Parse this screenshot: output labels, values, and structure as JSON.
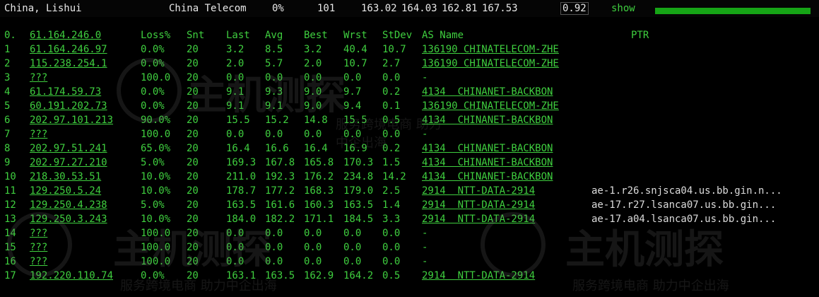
{
  "header": {
    "location": "China, Lishui",
    "isp": "China Telecom",
    "loss": "0%",
    "sent": "101",
    "last": "163.02",
    "avg": "164.03",
    "best": "162.81",
    "worst": "167.53",
    "stdev": "0.92",
    "show_label": "show",
    "bar_fill": 1.0
  },
  "columns": {
    "host": "61.164.246.0",
    "idx0": "0.",
    "loss": "Loss%",
    "snt": "Snt",
    "last": "Last",
    "avg": "Avg",
    "best": "Best",
    "wrst": "Wrst",
    "stdev": "StDev",
    "as": "AS Name",
    "ptr": "PTR"
  },
  "hops": [
    {
      "idx": "1",
      "host": "61.164.246.97",
      "loss": "0.0%",
      "snt": "20",
      "last": "3.2",
      "avg": "8.5",
      "best": "3.2",
      "wrst": "40.4",
      "stdev": "10.7",
      "as": "136190 CHINATELECOM-ZHE",
      "ptr": ""
    },
    {
      "idx": "2",
      "host": "115.238.254.1",
      "loss": "0.0%",
      "snt": "20",
      "last": "2.0",
      "avg": "5.7",
      "best": "2.0",
      "wrst": "10.7",
      "stdev": "2.7",
      "as": "136190 CHINATELECOM-ZHE",
      "ptr": ""
    },
    {
      "idx": "3",
      "host": "???",
      "loss": "100.0",
      "snt": "20",
      "last": "0.0",
      "avg": "0.0",
      "best": "0.0",
      "wrst": "0.0",
      "stdev": "0.0",
      "as": "-",
      "ptr": ""
    },
    {
      "idx": "4",
      "host": "61.174.59.73",
      "loss": "0.0%",
      "snt": "20",
      "last": "9.1",
      "avg": "9.3",
      "best": "9.0",
      "wrst": "9.7",
      "stdev": "0.2",
      "as": "4134  CHINANET-BACKBON",
      "ptr": ""
    },
    {
      "idx": "5",
      "host": "60.191.202.73",
      "loss": "0.0%",
      "snt": "20",
      "last": "9.1",
      "avg": "9.1",
      "best": "9.0",
      "wrst": "9.4",
      "stdev": "0.1",
      "as": "136190 CHINATELECOM-ZHE",
      "ptr": ""
    },
    {
      "idx": "6",
      "host": "202.97.101.213",
      "loss": "90.0%",
      "snt": "20",
      "last": "15.5",
      "avg": "15.2",
      "best": "14.8",
      "wrst": "15.5",
      "stdev": "0.5",
      "as": "4134  CHINANET-BACKBON",
      "ptr": ""
    },
    {
      "idx": "7",
      "host": "???",
      "loss": "100.0",
      "snt": "20",
      "last": "0.0",
      "avg": "0.0",
      "best": "0.0",
      "wrst": "0.0",
      "stdev": "0.0",
      "as": "-",
      "ptr": ""
    },
    {
      "idx": "8",
      "host": "202.97.51.241",
      "loss": "65.0%",
      "snt": "20",
      "last": "16.4",
      "avg": "16.6",
      "best": "16.4",
      "wrst": "16.9",
      "stdev": "0.2",
      "as": "4134  CHINANET-BACKBON",
      "ptr": ""
    },
    {
      "idx": "9",
      "host": "202.97.27.210",
      "loss": "5.0%",
      "snt": "20",
      "last": "169.3",
      "avg": "167.8",
      "best": "165.8",
      "wrst": "170.3",
      "stdev": "1.5",
      "as": "4134  CHINANET-BACKBON",
      "ptr": ""
    },
    {
      "idx": "10",
      "host": "218.30.53.51",
      "loss": "10.0%",
      "snt": "20",
      "last": "211.0",
      "avg": "192.3",
      "best": "176.2",
      "wrst": "234.8",
      "stdev": "14.2",
      "as": "4134  CHINANET-BACKBON",
      "ptr": ""
    },
    {
      "idx": "11",
      "host": "129.250.5.24",
      "loss": "10.0%",
      "snt": "20",
      "last": "178.7",
      "avg": "177.2",
      "best": "168.3",
      "wrst": "179.0",
      "stdev": "2.5",
      "as": "2914  NTT-DATA-2914",
      "ptr": "ae-1.r26.snjsca04.us.bb.gin.n..."
    },
    {
      "idx": "12",
      "host": "129.250.4.238",
      "loss": "5.0%",
      "snt": "20",
      "last": "163.5",
      "avg": "161.6",
      "best": "160.3",
      "wrst": "163.5",
      "stdev": "1.4",
      "as": "2914  NTT-DATA-2914",
      "ptr": "ae-17.r27.lsanca07.us.bb.gin..."
    },
    {
      "idx": "13",
      "host": "129.250.3.243",
      "loss": "10.0%",
      "snt": "20",
      "last": "184.0",
      "avg": "182.2",
      "best": "171.1",
      "wrst": "184.5",
      "stdev": "3.3",
      "as": "2914  NTT-DATA-2914",
      "ptr": "ae-17.a04.lsanca07.us.bb.gin..."
    },
    {
      "idx": "14",
      "host": "???",
      "loss": "100.0",
      "snt": "20",
      "last": "0.0",
      "avg": "0.0",
      "best": "0.0",
      "wrst": "0.0",
      "stdev": "0.0",
      "as": "-",
      "ptr": ""
    },
    {
      "idx": "15",
      "host": "???",
      "loss": "100.0",
      "snt": "20",
      "last": "0.0",
      "avg": "0.0",
      "best": "0.0",
      "wrst": "0.0",
      "stdev": "0.0",
      "as": "-",
      "ptr": ""
    },
    {
      "idx": "16",
      "host": "???",
      "loss": "100.0",
      "snt": "20",
      "last": "0.0",
      "avg": "0.0",
      "best": "0.0",
      "wrst": "0.0",
      "stdev": "0.0",
      "as": "-",
      "ptr": ""
    },
    {
      "idx": "17",
      "host": "192.220.110.74",
      "loss": "0.0%",
      "snt": "20",
      "last": "163.1",
      "avg": "163.5",
      "best": "162.9",
      "wrst": "164.2",
      "stdev": "0.5",
      "as": "2914  NTT-DATA-2914",
      "ptr": ""
    }
  ],
  "watermark": {
    "brand": "主机测探",
    "slogan": "服务跨境电商 助力中企出海"
  }
}
